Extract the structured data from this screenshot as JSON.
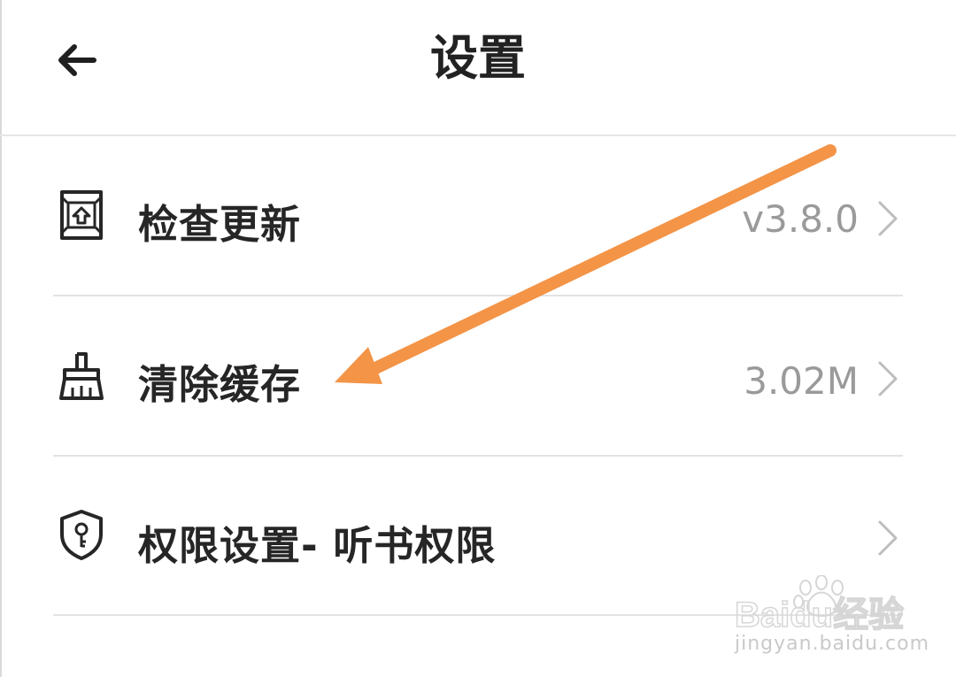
{
  "header": {
    "title": "设置",
    "back_icon": "arrow-left-icon"
  },
  "settings": {
    "items": [
      {
        "icon": "update-icon",
        "label": "检查更新",
        "value": "v3.8.0"
      },
      {
        "icon": "broom-icon",
        "label": "清除缓存",
        "value": "3.02M"
      },
      {
        "icon": "shield-key-icon",
        "label": "权限设置- 听书权限",
        "value": ""
      }
    ]
  },
  "annotation": {
    "arrow_color": "#f39447"
  },
  "watermark": {
    "brand": "Baidu经验",
    "url": "jingyan.baidu.com"
  }
}
